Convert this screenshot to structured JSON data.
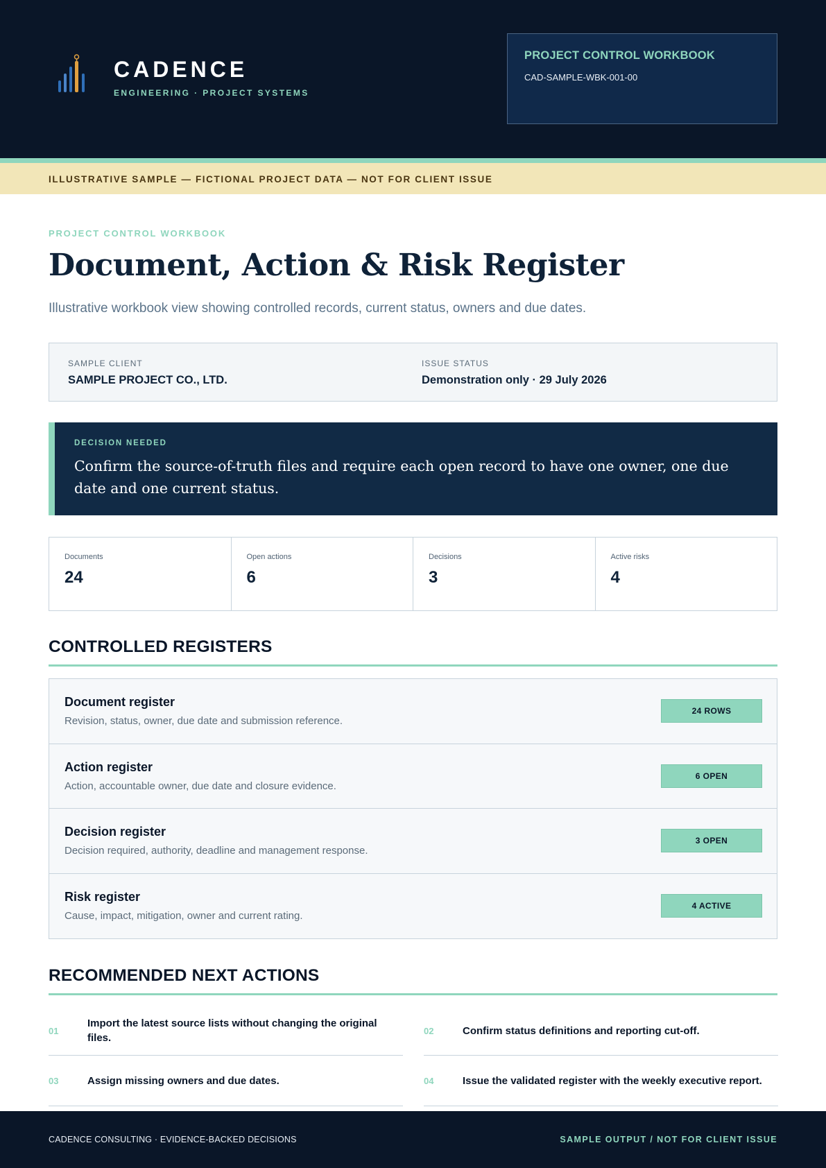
{
  "header": {
    "brand_name": "CADENCE",
    "brand_tagline": "ENGINEERING · PROJECT SYSTEMS",
    "workbook_title": "PROJECT CONTROL WORKBOOK",
    "workbook_code": "CAD-SAMPLE-WBK-001-00"
  },
  "banner": {
    "text": "ILLUSTRATIVE SAMPLE — FICTIONAL PROJECT DATA — NOT FOR CLIENT ISSUE"
  },
  "title_block": {
    "eyebrow": "PROJECT CONTROL WORKBOOK",
    "title": "Document, Action & Risk Register",
    "subtitle": "Illustrative workbook view showing controlled records, current status, owners and due dates."
  },
  "meta": {
    "client_label": "SAMPLE CLIENT",
    "client_value": "SAMPLE PROJECT CO., LTD.",
    "status_label": "ISSUE STATUS",
    "status_value": "Demonstration only · 29 July 2026"
  },
  "decision": {
    "label": "DECISION NEEDED",
    "text": "Confirm the source-of-truth files and require each open record to have one owner, one due date and one current status."
  },
  "stats": [
    {
      "label": "Documents",
      "value": "24"
    },
    {
      "label": "Open actions",
      "value": "6"
    },
    {
      "label": "Decisions",
      "value": "3"
    },
    {
      "label": "Active risks",
      "value": "4"
    }
  ],
  "registers": {
    "heading": "CONTROLLED REGISTERS",
    "items": [
      {
        "title": "Document register",
        "description": "Revision, status, owner, due date and submission reference.",
        "badge": "24 ROWS"
      },
      {
        "title": "Action register",
        "description": "Action, accountable owner, due date and closure evidence.",
        "badge": "6 OPEN"
      },
      {
        "title": "Decision register",
        "description": "Decision required, authority, deadline and management response.",
        "badge": "3 OPEN"
      },
      {
        "title": "Risk register",
        "description": "Cause, impact, mitigation, owner and current rating.",
        "badge": "4 ACTIVE"
      }
    ]
  },
  "next_actions": {
    "heading": "RECOMMENDED NEXT ACTIONS",
    "items": [
      {
        "number": "01",
        "text": "Import the latest source lists without changing the original files."
      },
      {
        "number": "02",
        "text": "Confirm status definitions and reporting cut-off."
      },
      {
        "number": "03",
        "text": "Assign missing owners and due dates."
      },
      {
        "number": "04",
        "text": "Issue the validated register with the weekly executive report."
      }
    ]
  },
  "footer": {
    "left": "CADENCE CONSULTING · EVIDENCE-BACKED DECISIONS",
    "right": "SAMPLE OUTPUT / NOT FOR CLIENT ISSUE"
  },
  "colors": {
    "navy": "#0a1628",
    "mint_accent": "#8fd6bd",
    "banner": "#f2e6b8",
    "logo_blue": "#2f6fb8",
    "logo_orange": "#e0a040"
  }
}
